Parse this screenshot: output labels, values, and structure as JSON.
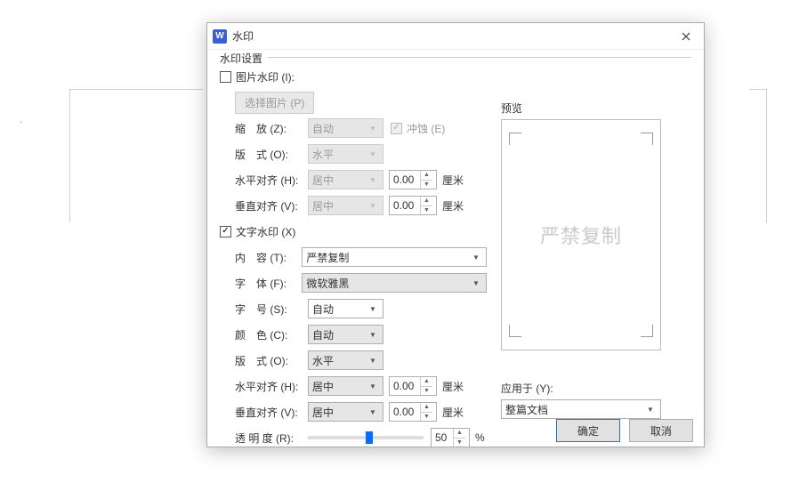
{
  "dialog": {
    "title": "水印",
    "app_icon_letter": "W"
  },
  "fieldset": {
    "legend": "水印设置"
  },
  "image_wm": {
    "checkbox_label": "图片水印 (I):",
    "select_image_btn": "选择图片 (P)",
    "scale_label": "缩　放 (Z):",
    "scale_value": "自动",
    "washout_label": "冲蚀 (E)",
    "layout_label": "版　式 (O):",
    "layout_value": "水平",
    "halign_label": "水平对齐 (H):",
    "halign_value": "居中",
    "halign_num": "0.00",
    "valign_label": "垂直对齐 (V):",
    "valign_value": "居中",
    "valign_num": "0.00",
    "unit": "厘米"
  },
  "text_wm": {
    "checkbox_label": "文字水印 (X)",
    "content_label": "内　容 (T):",
    "content_value": "严禁复制",
    "font_label": "字　体 (F):",
    "font_value": "微软雅黑",
    "size_label": "字　号 (S):",
    "size_value": "自动",
    "color_label": "颜　色 (C):",
    "color_value": "自动",
    "layout_label": "版　式 (O):",
    "layout_value": "水平",
    "halign_label": "水平对齐 (H):",
    "halign_value": "居中",
    "halign_num": "0.00",
    "valign_label": "垂直对齐 (V):",
    "valign_value": "居中",
    "valign_num": "0.00",
    "opacity_label": "透 明 度 (R):",
    "opacity_value": "50",
    "opacity_unit": "%",
    "unit": "厘米"
  },
  "preview": {
    "title": "预览",
    "watermark_text": "严禁复制"
  },
  "apply": {
    "label": "应用于 (Y):",
    "value": "整篇文档"
  },
  "footer": {
    "ok": "确定",
    "cancel": "取消"
  }
}
